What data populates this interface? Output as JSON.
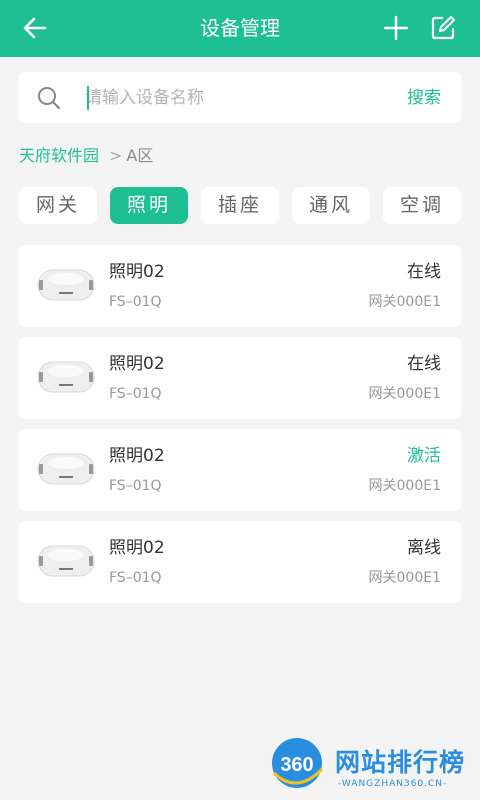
{
  "header": {
    "title": "设备管理",
    "back_icon": "arrow-left-icon",
    "add_icon": "plus-icon",
    "edit_icon": "edit-icon"
  },
  "search": {
    "placeholder": "请输入设备名称",
    "value": "",
    "button_label": "搜索"
  },
  "breadcrumb": {
    "root": "天府软件园",
    "separator": ">",
    "current": "A区"
  },
  "tabs": [
    {
      "label": "网关",
      "active": false
    },
    {
      "label": "照明",
      "active": true
    },
    {
      "label": "插座",
      "active": false
    },
    {
      "label": "通风",
      "active": false
    },
    {
      "label": "空调",
      "active": false
    }
  ],
  "devices": [
    {
      "name": "照明02",
      "model": "FS–01Q",
      "status": "在线",
      "gateway": "网关000E1"
    },
    {
      "name": "照明02",
      "model": "FS–01Q",
      "status": "在线",
      "gateway": "网关000E1"
    },
    {
      "name": "照明02",
      "model": "FS–01Q",
      "status": "激活",
      "gateway": "网关000E1"
    },
    {
      "name": "照明02",
      "model": "FS–01Q",
      "status": "离线",
      "gateway": "网关000E1"
    }
  ],
  "watermark": {
    "logo_number": "360",
    "title": "网站排行榜",
    "subtitle": "-WANGZHAN360.CN-"
  },
  "colors": {
    "accent": "#1fbf96",
    "background": "#f4f4f4",
    "watermark": "#2a8ee0"
  }
}
